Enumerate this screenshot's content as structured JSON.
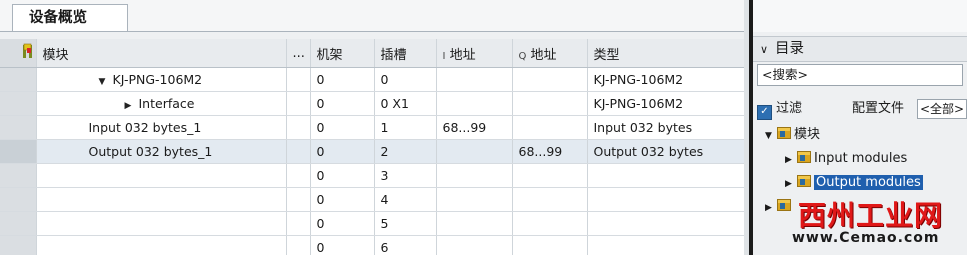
{
  "tab": {
    "title": "设备概览"
  },
  "columns": {
    "module": "模块",
    "dots": "...",
    "rack": "机架",
    "slot": "插槽",
    "i_prefix": "I",
    "i_addr": "地址",
    "q_prefix": "Q",
    "q_addr": "地址",
    "type": "类型"
  },
  "rows": [
    {
      "module": "KJ-PNG-106M2",
      "rack": "0",
      "slot": "0",
      "i_addr": "",
      "q_addr": "",
      "type": "KJ-PNG-106M2",
      "caret": "▼"
    },
    {
      "module": "Interface",
      "rack": "0",
      "slot": "0 X1",
      "i_addr": "",
      "q_addr": "",
      "type": "KJ-PNG-106M2",
      "caret": "▶"
    },
    {
      "module": "Input 032 bytes_1",
      "rack": "0",
      "slot": "1",
      "i_addr": "68...99",
      "q_addr": "",
      "type": "Input 032 bytes",
      "caret": ""
    },
    {
      "module": "Output 032 bytes_1",
      "rack": "0",
      "slot": "2",
      "i_addr": "",
      "q_addr": "68...99",
      "type": "Output 032 bytes",
      "caret": ""
    },
    {
      "module": "",
      "rack": "0",
      "slot": "3",
      "i_addr": "",
      "q_addr": "",
      "type": "",
      "caret": ""
    },
    {
      "module": "",
      "rack": "0",
      "slot": "4",
      "i_addr": "",
      "q_addr": "",
      "type": "",
      "caret": ""
    },
    {
      "module": "",
      "rack": "0",
      "slot": "5",
      "i_addr": "",
      "q_addr": "",
      "type": "",
      "caret": ""
    },
    {
      "module": "",
      "rack": "0",
      "slot": "6",
      "i_addr": "",
      "q_addr": "",
      "type": "",
      "caret": ""
    }
  ],
  "catalog": {
    "chevron": "∨",
    "title": "目录",
    "search_value": "<搜索>",
    "filter_label": "过滤",
    "profile_label": "配置文件",
    "profile_value": "<全部>",
    "tree": {
      "root": "模块",
      "child1": "Input modules",
      "child2": "Output modules"
    }
  },
  "watermark": {
    "cn": "西州工业网",
    "url": "www.Cemao.com"
  },
  "colors": {
    "selection": "#1f5fae",
    "checkbox": "#2d6fb2",
    "watermark": "#e01818"
  }
}
